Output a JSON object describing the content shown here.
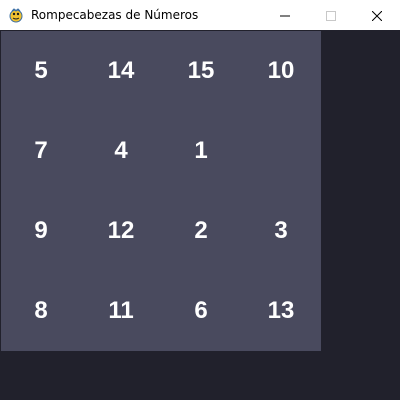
{
  "window": {
    "title": "Rompecabezas de Números",
    "icon": "pygame-snake-icon"
  },
  "controls": {
    "minimize_icon": "minimize-icon",
    "maximize_icon": "maximize-icon",
    "close_icon": "close-icon"
  },
  "colors": {
    "background": "#21212c",
    "board": "#494a5e",
    "tile_text": "#ffffff"
  },
  "board": {
    "rows": [
      [
        "5",
        "14",
        "15",
        "10"
      ],
      [
        "7",
        "4",
        "1",
        ""
      ],
      [
        "9",
        "12",
        "2",
        "3"
      ],
      [
        "8",
        "11",
        "6",
        "13"
      ]
    ]
  }
}
